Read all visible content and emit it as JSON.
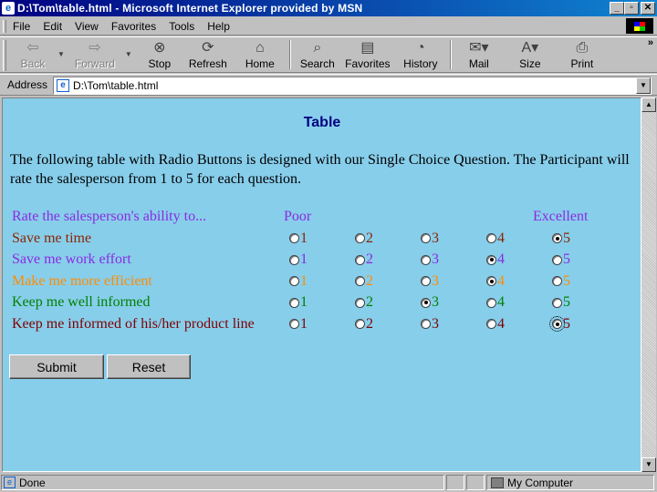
{
  "window": {
    "title": "D:\\Tom\\table.html - Microsoft Internet Explorer provided by MSN",
    "buttons": {
      "minimize": "_",
      "maximize": "▫",
      "close": "✕"
    }
  },
  "menu": [
    {
      "label": "File"
    },
    {
      "label": "Edit"
    },
    {
      "label": "View"
    },
    {
      "label": "Favorites"
    },
    {
      "label": "Tools"
    },
    {
      "label": "Help"
    }
  ],
  "toolbar": {
    "back": "Back",
    "forward": "Forward",
    "stop": "Stop",
    "refresh": "Refresh",
    "home": "Home",
    "search": "Search",
    "favorites": "Favorites",
    "history": "History",
    "mail": "Mail",
    "size": "Size",
    "print": "Print"
  },
  "address": {
    "label": "Address",
    "url": "D:\\Tom\\table.html"
  },
  "page": {
    "title": "Table",
    "intro": "The following table with Radio Buttons is designed with our Single Choice Question. The Participant will rate the salesperson from 1 to 5 for each question.",
    "header": {
      "prompt": "Rate the salesperson's ability to...",
      "poor": "Poor",
      "excellent": "Excellent"
    },
    "questions": [
      {
        "label": "Save me time",
        "color": "#8b2500",
        "selected": 5,
        "options": [
          "1",
          "2",
          "3",
          "4",
          "5"
        ]
      },
      {
        "label": "Save me work effort",
        "color": "#8a2be2",
        "selected": 4,
        "options": [
          "1",
          "2",
          "3",
          "4",
          "5"
        ]
      },
      {
        "label": "Make me more efficient",
        "color": "#ff8c00",
        "selected": 4,
        "options": [
          "1",
          "2",
          "3",
          "4",
          "5"
        ]
      },
      {
        "label": "Keep me well informed",
        "color": "#008000",
        "selected": 3,
        "options": [
          "1",
          "2",
          "3",
          "4",
          "5"
        ]
      },
      {
        "label": "Keep me informed of his/her product line",
        "color": "#800000",
        "selected": 5,
        "options": [
          "1",
          "2",
          "3",
          "4",
          "5"
        ]
      }
    ],
    "header_color": "#8a2be2",
    "submit": "Submit",
    "reset": "Reset"
  },
  "status": {
    "text": "Done",
    "zone": "My Computer"
  }
}
